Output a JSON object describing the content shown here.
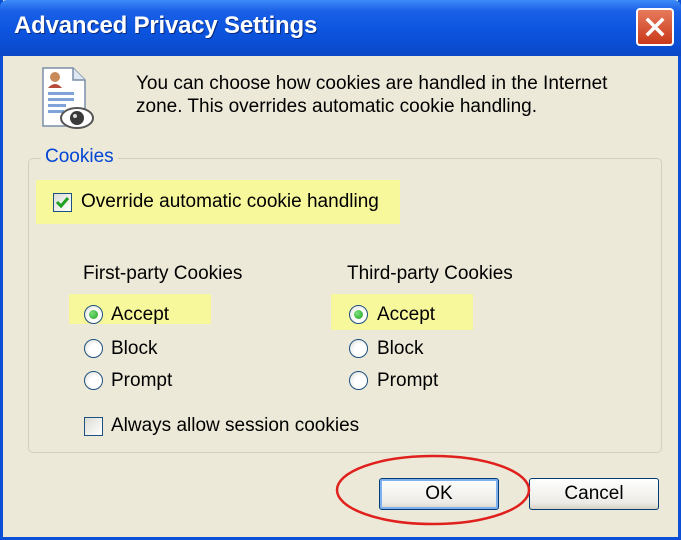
{
  "window": {
    "title": "Advanced Privacy Settings",
    "close_icon": "close-icon"
  },
  "intro": {
    "icon": "privacy-document-eye-icon",
    "text": "You can choose how cookies are handled in the Internet zone.  This overrides automatic cookie handling."
  },
  "cookies": {
    "group_label": "Cookies",
    "override_label": "Override automatic cookie handling",
    "override_checked": true,
    "first_party": {
      "heading": "First-party Cookies",
      "options": [
        "Accept",
        "Block",
        "Prompt"
      ],
      "selected": "Accept"
    },
    "third_party": {
      "heading": "Third-party Cookies",
      "options": [
        "Accept",
        "Block",
        "Prompt"
      ],
      "selected": "Accept"
    },
    "session_label": "Always allow session cookies",
    "session_checked": false
  },
  "buttons": {
    "ok": "OK",
    "cancel": "Cancel"
  },
  "colors": {
    "highlight": "#f7f79c",
    "annotation": "#e0201c",
    "title_blue": "#0c55e0"
  }
}
